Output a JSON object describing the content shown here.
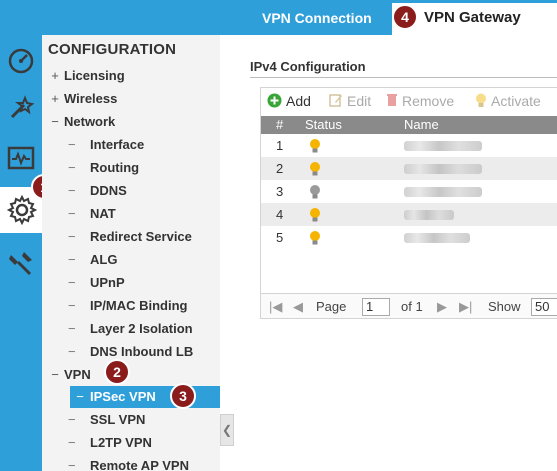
{
  "tabs": {
    "vpn_connection": "VPN Connection",
    "vpn_gateway": "VPN Gateway"
  },
  "badges": [
    "1",
    "2",
    "3",
    "4"
  ],
  "sidebar_icons": [
    "dashboard-icon",
    "quick-setup-icon",
    "monitor-icon",
    "configuration-gear-icon",
    "maintenance-tools-icon"
  ],
  "nav": {
    "title": "CONFIGURATION",
    "items": [
      {
        "prefix": "+",
        "label": "Licensing"
      },
      {
        "prefix": "+",
        "label": "Wireless"
      },
      {
        "prefix": "−",
        "label": "Network"
      },
      {
        "prefix": "−",
        "label": "Interface"
      },
      {
        "prefix": "−",
        "label": "Routing"
      },
      {
        "prefix": "−",
        "label": "DDNS"
      },
      {
        "prefix": "−",
        "label": "NAT"
      },
      {
        "prefix": "−",
        "label": "Redirect Service"
      },
      {
        "prefix": "−",
        "label": "ALG"
      },
      {
        "prefix": "−",
        "label": "UPnP"
      },
      {
        "prefix": "−",
        "label": "IP/MAC Binding"
      },
      {
        "prefix": "−",
        "label": "Layer 2 Isolation"
      },
      {
        "prefix": "−",
        "label": "DNS Inbound LB"
      },
      {
        "prefix": "−",
        "label": "VPN"
      },
      {
        "prefix": "−",
        "label": "IPSec VPN"
      },
      {
        "prefix": "−",
        "label": "SSL VPN"
      },
      {
        "prefix": "−",
        "label": "L2TP VPN"
      },
      {
        "prefix": "−",
        "label": "Remote AP VPN"
      }
    ]
  },
  "section": {
    "title": "IPv4 Configuration"
  },
  "toolbar": {
    "add": "Add",
    "edit": "Edit",
    "remove": "Remove",
    "activate": "Activate"
  },
  "table": {
    "columns": [
      "#",
      "Status",
      "Name"
    ],
    "rows": [
      {
        "index": "1",
        "status": "active"
      },
      {
        "index": "2",
        "status": "active"
      },
      {
        "index": "3",
        "status": "inactive"
      },
      {
        "index": "4",
        "status": "active"
      },
      {
        "index": "5",
        "status": "active"
      }
    ]
  },
  "pager": {
    "page_label": "Page",
    "page_value": "1",
    "of_label": "of 1",
    "show_label": "Show",
    "show_value": "50"
  },
  "colors": {
    "accent": "#2f9fda",
    "badge": "#8b1c1c",
    "bulb_on": "#f5b400",
    "bulb_off": "#9a9a9a"
  }
}
